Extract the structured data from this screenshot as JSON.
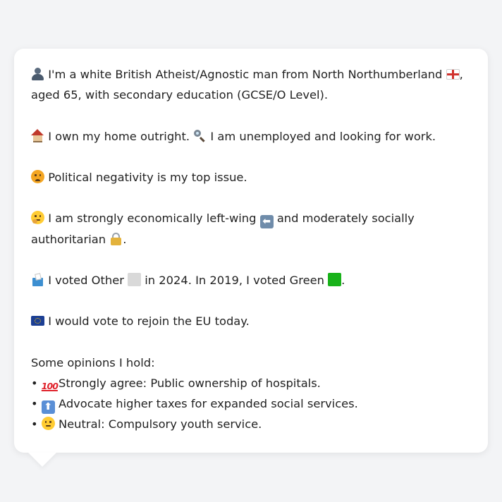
{
  "profile": {
    "intro": "I'm a white British Atheist/Agnostic man from North Northumberland",
    "intro_end": ",",
    "intro_line2": "aged 65, with secondary education (GCSE/O Level).",
    "home": "I own my home outright.",
    "employment": "I am unemployed and looking for work.",
    "top_issue": "Political negativity is my top issue.",
    "economic_pre": "I am strongly economically left-wing",
    "economic_mid": "and moderately socially",
    "social_line2": "authoritarian",
    "social_end": ".",
    "vote_2024_pre": "I voted Other",
    "vote_2024_post": "in 2024. In 2019, I voted Green",
    "vote_end": ".",
    "eu": "I would vote to rejoin the EU today."
  },
  "opinions": {
    "heading": "Some opinions I hold:",
    "bullet": "•",
    "items": [
      {
        "icon": "hundred-icon",
        "text": "Strongly agree: Public ownership of hospitals."
      },
      {
        "icon": "up-arrow-icon",
        "text": "Advocate higher taxes for expanded social services."
      },
      {
        "icon": "neutral-face-icon",
        "text": "Neutral: Compulsory youth service."
      }
    ]
  },
  "icons": {
    "person": "person-icon",
    "flag": "england-flag-icon",
    "house": "house-icon",
    "search": "magnifier-icon",
    "angry": "angry-face-icon",
    "thinking": "thinking-face-icon",
    "left_arrow": "left-arrow-icon",
    "lock": "lock-icon",
    "ballot": "ballot-box-icon",
    "other_square": "white-square-icon",
    "green_square": "green-square-icon",
    "eu_flag": "eu-flag-icon",
    "up_symbol": "⬆",
    "left_symbol": "⬅"
  },
  "colors": {
    "background": "#f3f4f6",
    "bubble": "#ffffff",
    "text": "#222222",
    "green_party": "#19b21a",
    "other_party": "#d9d9d9"
  }
}
